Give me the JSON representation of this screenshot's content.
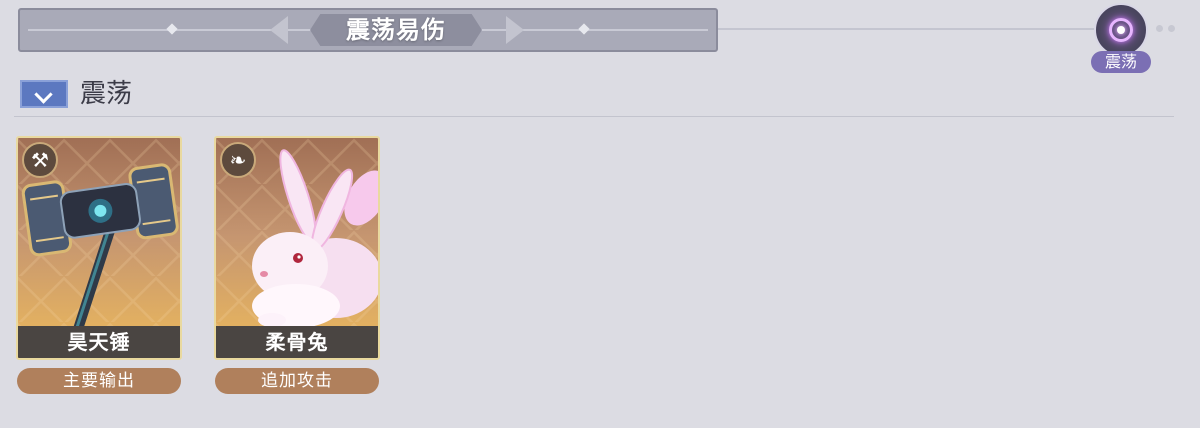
{
  "header": {
    "title": "震荡易伤"
  },
  "status": {
    "label": "震荡",
    "icon": "vortex-icon",
    "accent_color": "#7b6fb4"
  },
  "section": {
    "title": "震荡",
    "expanded": true
  },
  "cards": [
    {
      "name": "昊天锤",
      "role": "主要输出",
      "badge_icon": "hammer-class-icon",
      "badge_glyph": "⚒",
      "art": "hammer"
    },
    {
      "name": "柔骨兔",
      "role": "追加攻击",
      "badge_icon": "wing-class-icon",
      "badge_glyph": "❧",
      "art": "rabbit"
    }
  ]
}
